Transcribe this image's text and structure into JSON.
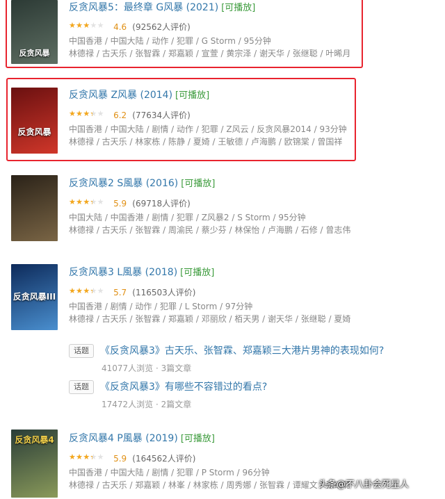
{
  "movies": [
    {
      "title": "反贪风暴5：最终章 G风暴 (2021)",
      "playable": "[可播放]",
      "rating": 4.6,
      "rating_text": "4.6",
      "votes": "(92562人评价)",
      "meta": "中国香港 / 中国大陆 / 动作 / 犯罪 / G Storm / 95分钟",
      "cast": "林德禄 / 古天乐 / 张智霖 / 郑嘉颖 / 宣萱 / 黄宗泽 / 谢天华 / 张继聪 / 叶晞月",
      "poster_text": "反贪风暴",
      "poster_colors": [
        "#2c3a35",
        "#5e6e62"
      ],
      "highlighted": true
    },
    {
      "title": "反贪风暴 Z风暴 (2014)",
      "playable": "[可播放]",
      "rating": 6.2,
      "rating_text": "6.2",
      "votes": "(77634人评价)",
      "meta": "中国香港 / 中国大陆 / 剧情 / 动作 / 犯罪 / Z风云 / 反贪风暴2014 / 93分钟",
      "cast": "林德禄 / 古天乐 / 林家栋 / 陈静 / 夏婍 / 王敏德 / 卢海鹏 / 欧锦棠 / 曾国祥",
      "poster_text": "反贪风暴",
      "poster_colors": [
        "#6a1010",
        "#d0372a"
      ],
      "highlighted": true
    },
    {
      "title": "反贪风暴2 S風暴 (2016)",
      "playable": "[可播放]",
      "rating": 5.9,
      "rating_text": "5.9",
      "votes": "(69718人评价)",
      "meta": "中国大陆 / 中国香港 / 剧情 / 犯罪 / Z风暴2 / S Storm / 95分钟",
      "cast": "林德禄 / 古天乐 / 张智霖 / 周渝民 / 蔡少芬 / 林保怡 / 卢海鹏 / 石修 / 曾志伟",
      "poster_text": "",
      "poster_colors": [
        "#2a2218",
        "#7a6545"
      ],
      "highlighted": false
    },
    {
      "title": "反贪风暴3 L風暴 (2018)",
      "playable": "[可播放]",
      "rating": 5.7,
      "rating_text": "5.7",
      "votes": "(116503人评价)",
      "meta": "中国香港 / 剧情 / 动作 / 犯罪 / L Storm / 97分钟",
      "cast": "林德禄 / 古天乐 / 张智霖 / 郑嘉颖 / 邓丽欣 / 栢天男 / 谢天华 / 张继聪 / 夏婍",
      "poster_text": "反贪风暴III",
      "poster_colors": [
        "#0d2a5a",
        "#4a8fcf"
      ],
      "highlighted": false
    },
    {
      "title": "反贪风暴4 P風暴 (2019)",
      "playable": "[可播放]",
      "rating": 5.9,
      "rating_text": "5.9",
      "votes": "(164562人评价)",
      "meta": "中国香港 / 中国大陆 / 剧情 / 犯罪 / P Storm / 96分钟",
      "cast": "林德禄 / 古天乐 / 郑嘉颖 / 林峯 / 林家栋 / 周秀娜 / 张智霖 / 谭耀文 / 张继聪",
      "poster_text": "反贪风暴4",
      "poster_colors": [
        "#2a3d38",
        "#8a9a5a"
      ],
      "highlighted": false
    }
  ],
  "topics": [
    {
      "tag": "话题",
      "title": "《反贪风暴3》古天乐、张智霖、郑嘉颖三大港片男神的表现如何?",
      "stats": "41077人浏览 · 3篇文章"
    },
    {
      "tag": "话题",
      "title": "《反贪风暴3》有哪些不容错过的看点?",
      "stats": "17472人浏览 · 2篇文章"
    }
  ],
  "watermark": "头条@不八卦会死星人",
  "colors": {
    "link": "#3377aa",
    "playable": "#3a9a3a",
    "star": "#f4a71c",
    "highlight_border": "#e8232e"
  }
}
